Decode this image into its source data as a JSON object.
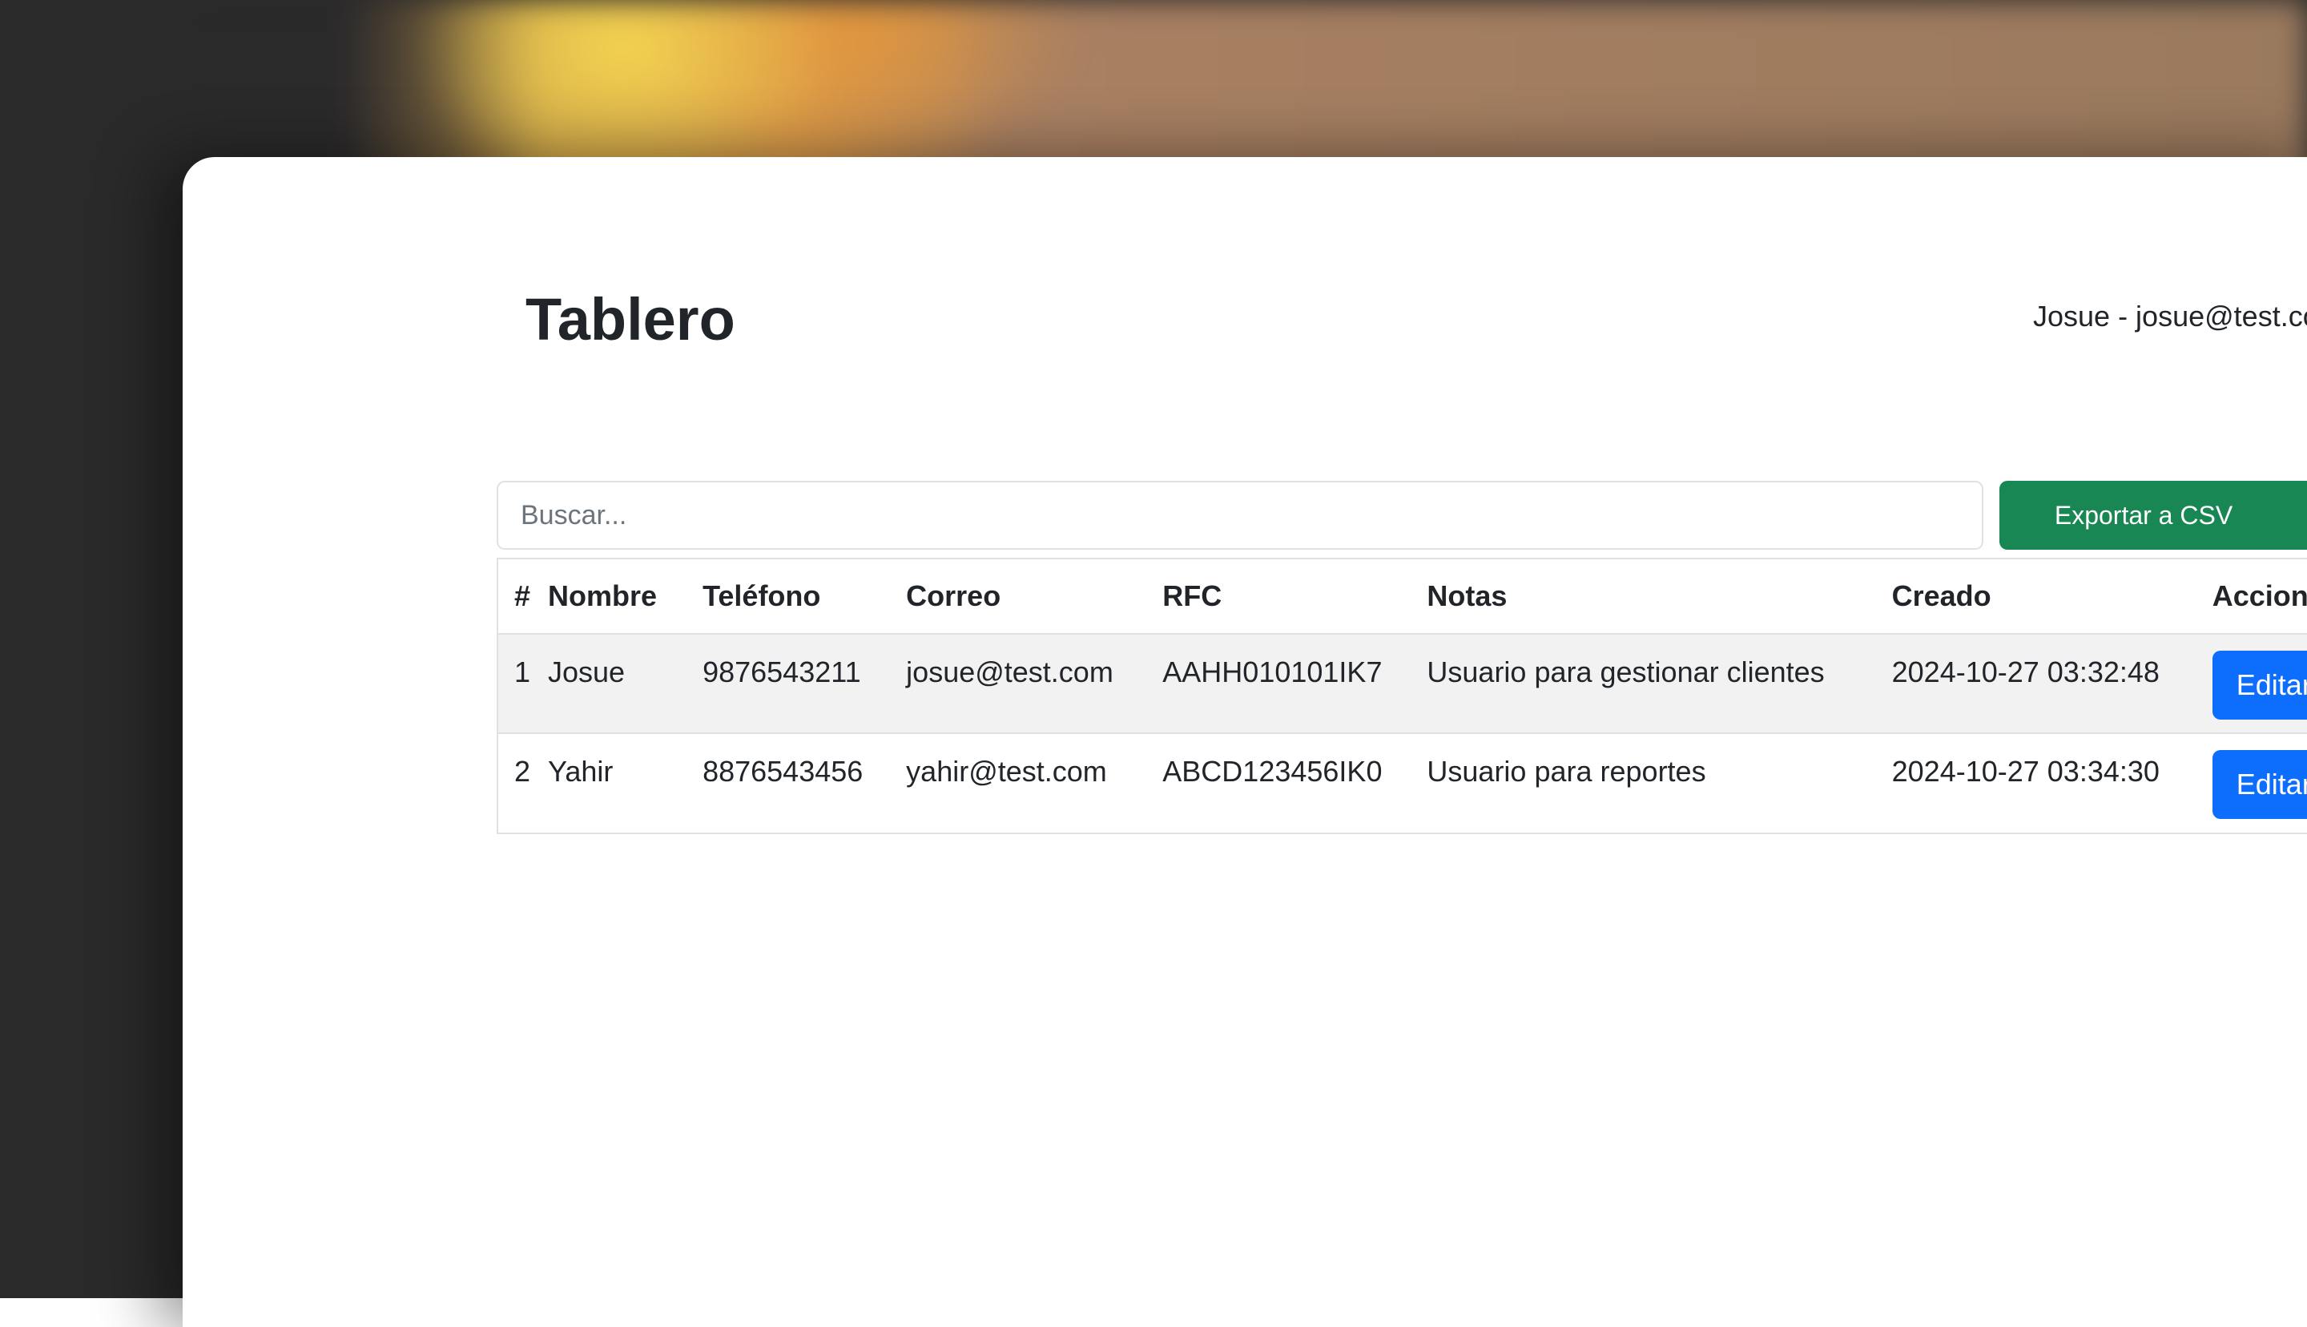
{
  "header": {
    "title": "Tablero",
    "user": "Josue - josue@test.com"
  },
  "toolbar": {
    "search_placeholder": "Buscar...",
    "search_value": "",
    "export_label": "Exportar a CSV"
  },
  "table": {
    "columns": [
      "#",
      "Nombre",
      "Teléfono",
      "Correo",
      "RFC",
      "Notas",
      "Creado",
      "Acciones"
    ],
    "rows": [
      {
        "num": "1",
        "name": "Josue",
        "phone": "9876543211",
        "email": "josue@test.com",
        "rfc": "AAHH010101IK7",
        "notes": "Usuario para gestionar clientes",
        "created": "2024-10-27 03:32:48",
        "edit_label": "Editar"
      },
      {
        "num": "2",
        "name": "Yahir",
        "phone": "8876543456",
        "email": "yahir@test.com",
        "rfc": "ABCD123456IK0",
        "notes": "Usuario para reportes",
        "created": "2024-10-27 03:34:30",
        "edit_label": "Editar"
      }
    ]
  },
  "colors": {
    "export_button": "#198754",
    "edit_button": "#0d6efd",
    "striped_row": "#f2f2f2",
    "border": "#dee2e6",
    "text": "#212529"
  }
}
